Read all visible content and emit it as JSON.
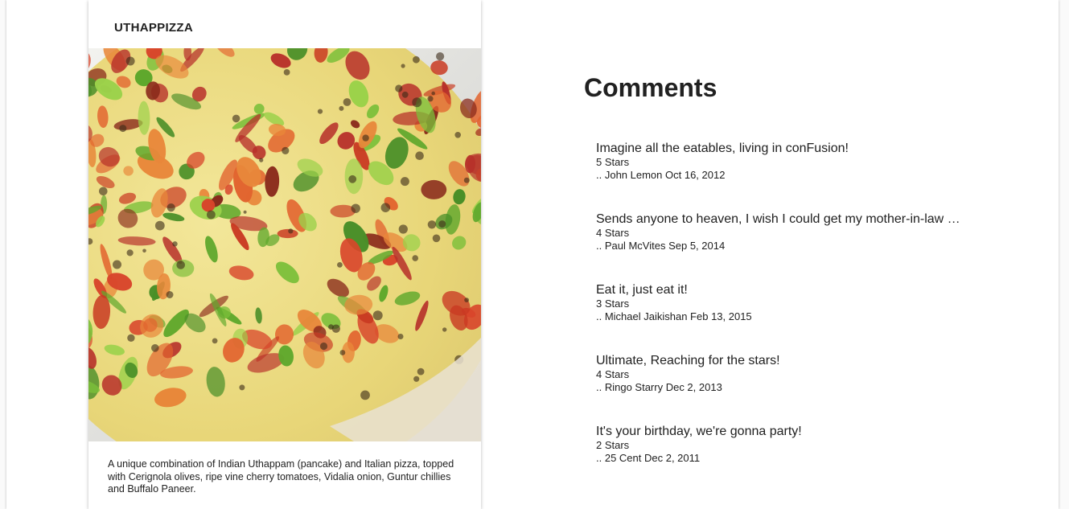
{
  "dish": {
    "name": "UTHAPPIZZA",
    "image_subject": "uthappizza-photo",
    "description": "A unique combination of Indian Uthappam (pancake) and Italian pizza, topped with Cerignola olives, ripe vine cherry tomatoes, Vidalia onion, Guntur chillies and Buffalo Paneer."
  },
  "comments": {
    "heading": "Comments",
    "items": [
      {
        "text": "Imagine all the eatables, living in conFusion!",
        "rating": "5 Stars",
        "meta": ".. John Lemon Oct 16, 2012"
      },
      {
        "text": "Sends anyone to heaven, I wish I could get my mother-in-law …",
        "rating": "4 Stars",
        "meta": ".. Paul McVites Sep 5, 2014"
      },
      {
        "text": "Eat it, just eat it!",
        "rating": "3 Stars",
        "meta": ".. Michael Jaikishan Feb 13, 2015"
      },
      {
        "text": "Ultimate, Reaching for the stars!",
        "rating": "4 Stars",
        "meta": ".. Ringo Starry Dec 2, 2013"
      },
      {
        "text": "It's your birthday, we're gonna party!",
        "rating": "2 Stars",
        "meta": ".. 25 Cent Dec 2, 2011"
      }
    ]
  }
}
